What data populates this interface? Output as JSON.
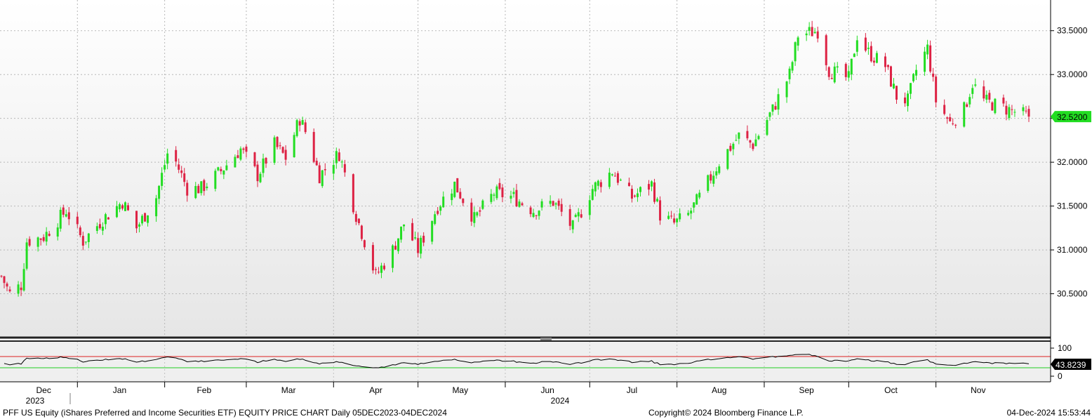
{
  "chart_data": [
    {
      "type": "candlestick",
      "title": "",
      "ylim": [
        30.0,
        33.85
      ],
      "y_ticks": [
        "30.5000",
        "31.0000",
        "31.5000",
        "32.0000",
        "32.5000",
        "33.0000",
        "33.5000"
      ],
      "last_price": "32.5200",
      "up_color": "#22dd22",
      "down_color": "#dd2244",
      "grid": true,
      "x_month_labels": [
        "Dec",
        "Jan",
        "Feb",
        "Mar",
        "Apr",
        "May",
        "Jun",
        "Jul",
        "Aug",
        "Sep",
        "Oct",
        "Nov"
      ],
      "x_year_labels": [
        "2023",
        "2024"
      ],
      "anchors": [
        [
          "2023-12-05",
          30.7
        ],
        [
          "2023-12-08",
          30.5
        ],
        [
          "2023-12-12",
          30.6
        ],
        [
          "2023-12-14",
          31.1
        ],
        [
          "2023-12-20",
          31.15
        ],
        [
          "2023-12-28",
          31.45
        ],
        [
          "2024-01-03",
          31.1
        ],
        [
          "2024-01-10",
          31.35
        ],
        [
          "2024-01-17",
          31.55
        ],
        [
          "2024-01-22",
          31.25
        ],
        [
          "2024-01-29",
          31.6
        ],
        [
          "2024-02-02",
          32.1
        ],
        [
          "2024-02-05",
          32.0
        ],
        [
          "2024-02-09",
          31.7
        ],
        [
          "2024-02-14",
          31.7
        ],
        [
          "2024-02-21",
          31.9
        ],
        [
          "2024-02-28",
          32.15
        ],
        [
          "2024-03-05",
          31.85
        ],
        [
          "2024-03-11",
          32.2
        ],
        [
          "2024-03-15",
          32.05
        ],
        [
          "2024-03-20",
          32.5
        ],
        [
          "2024-03-22",
          32.35
        ],
        [
          "2024-03-27",
          31.85
        ],
        [
          "2024-04-03",
          32.1
        ],
        [
          "2024-04-09",
          31.4
        ],
        [
          "2024-04-16",
          30.7
        ],
        [
          "2024-04-22",
          31.0
        ],
        [
          "2024-04-26",
          31.3
        ],
        [
          "2024-05-01",
          31.0
        ],
        [
          "2024-05-08",
          31.5
        ],
        [
          "2024-05-14",
          31.75
        ],
        [
          "2024-05-21",
          31.35
        ],
        [
          "2024-05-28",
          31.65
        ],
        [
          "2024-06-04",
          31.6
        ],
        [
          "2024-06-11",
          31.45
        ],
        [
          "2024-06-18",
          31.55
        ],
        [
          "2024-06-25",
          31.25
        ],
        [
          "2024-07-02",
          31.7
        ],
        [
          "2024-07-09",
          31.9
        ],
        [
          "2024-07-16",
          31.6
        ],
        [
          "2024-07-23",
          31.75
        ],
        [
          "2024-07-26",
          31.4
        ],
        [
          "2024-07-31",
          31.3
        ],
        [
          "2024-08-05",
          31.4
        ],
        [
          "2024-08-09",
          31.6
        ],
        [
          "2024-08-16",
          32.0
        ],
        [
          "2024-08-23",
          32.3
        ],
        [
          "2024-08-28",
          32.2
        ],
        [
          "2024-09-04",
          32.6
        ],
        [
          "2024-09-10",
          33.0
        ],
        [
          "2024-09-13",
          33.45
        ],
        [
          "2024-09-20",
          33.5
        ],
        [
          "2024-09-24",
          33.05
        ],
        [
          "2024-10-01",
          32.95
        ],
        [
          "2024-10-04",
          33.45
        ],
        [
          "2024-10-08",
          33.25
        ],
        [
          "2024-10-14",
          33.1
        ],
        [
          "2024-10-18",
          32.75
        ],
        [
          "2024-10-22",
          32.7
        ],
        [
          "2024-10-25",
          33.05
        ],
        [
          "2024-10-29",
          33.3
        ],
        [
          "2024-11-01",
          32.7
        ],
        [
          "2024-11-06",
          32.45
        ],
        [
          "2024-11-11",
          32.6
        ],
        [
          "2024-11-14",
          32.9
        ],
        [
          "2024-11-18",
          32.7
        ],
        [
          "2024-12-04",
          32.52
        ]
      ]
    },
    {
      "type": "line",
      "ylim": [
        0,
        100
      ],
      "y_ticks": [
        "100",
        "0"
      ],
      "overbought": 70,
      "oversold": 30,
      "last_value": "43.8239",
      "line_color": "#000000"
    }
  ],
  "footer": {
    "left": "PFF US Equity (iShares Preferred and Income Securities ETF) EQUITY PRICE CHART  Daily 05DEC2023-04DEC2024",
    "center": "Copyright© 2024 Bloomberg Finance L.P.",
    "right": "04-Dec-2024 15:53:44"
  }
}
